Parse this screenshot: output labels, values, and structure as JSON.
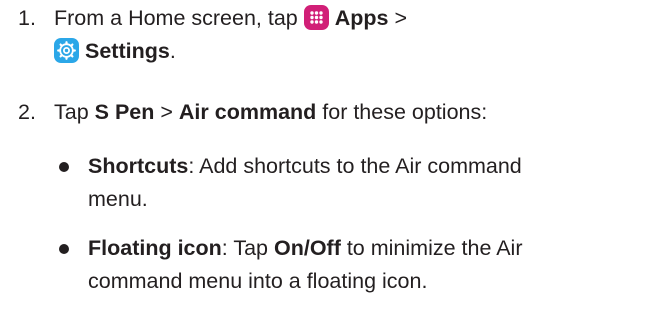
{
  "steps": [
    {
      "number": "1.",
      "line1_pre": "From a Home screen, tap ",
      "apps_icon": "apps-grid-icon",
      "apps_label": "Apps",
      "line1_post": " >",
      "settings_icon": "gear-icon",
      "settings_label": "Settings",
      "end": "."
    },
    {
      "number": "2.",
      "pre": "Tap ",
      "spen_label": "S Pen",
      "sep": " > ",
      "air_label": "Air command",
      "post": " for these options:"
    }
  ],
  "options": [
    {
      "term": "Shortcuts",
      "line1": ": Add shortcuts to the Air command",
      "line2": "menu."
    },
    {
      "term": "Floating icon",
      "mid1": ": Tap ",
      "onoff": "On/Off",
      "mid2": " to minimize the Air",
      "line2": "command menu into a floating icon."
    }
  ],
  "colors": {
    "text": "#231f20",
    "apps_icon_bg": "#d11f77",
    "settings_icon_bg": "#2ba7e8"
  }
}
